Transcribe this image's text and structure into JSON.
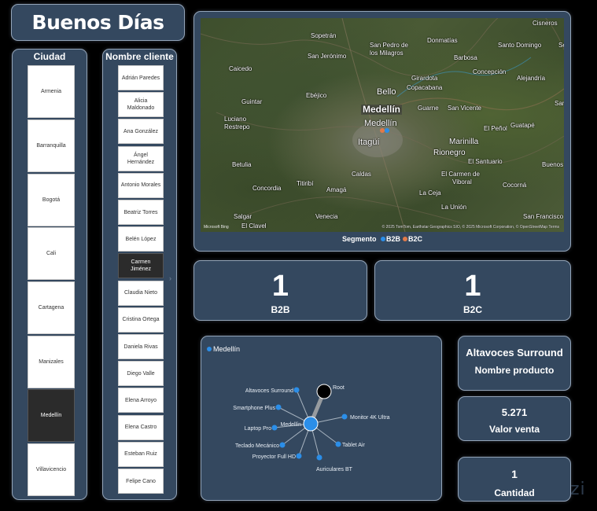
{
  "greeting": "Buenos Días",
  "city_slicer": {
    "header": "Ciudad",
    "items": [
      "Armenia",
      "Barranquilla",
      "Bogotá",
      "Cali",
      "Cartagena",
      "Manizales",
      "Medellín",
      "Villavicencio"
    ],
    "selected": "Medellín"
  },
  "client_slicer": {
    "header": "Nombre cliente",
    "items": [
      "Adrián Paredes",
      "Alicia Maldonado",
      "Ana González",
      "Ángel Hernández",
      "Antonio Morales",
      "Beatriz Torres",
      "Belén López",
      "Carmen Jiménez",
      "Claudia Nieto",
      "Cristina Ortega",
      "Daniela Rivas",
      "Diego Valle",
      "Elena Arroyo",
      "Elena Castro",
      "Esteban Ruiz",
      "Felipe Cano"
    ],
    "selected": "Carmen Jiménez",
    "scroll_arrow": "›"
  },
  "map": {
    "places": [
      {
        "name": "Cisneros",
        "cls": ""
      },
      {
        "name": "Sopetrán",
        "cls": ""
      },
      {
        "name": "Donmatías",
        "cls": ""
      },
      {
        "name": "San Pedro de",
        "cls": ""
      },
      {
        "name": "los Milagros",
        "cls": ""
      },
      {
        "name": "Santo Domingo",
        "cls": ""
      },
      {
        "name": "San Jerónimo",
        "cls": ""
      },
      {
        "name": "Barbosa",
        "cls": ""
      },
      {
        "name": "Caicedo",
        "cls": ""
      },
      {
        "name": "Concepción",
        "cls": ""
      },
      {
        "name": "Girardota",
        "cls": ""
      },
      {
        "name": "Alejandría",
        "cls": ""
      },
      {
        "name": "Copacabana",
        "cls": ""
      },
      {
        "name": "Bello",
        "cls": "big"
      },
      {
        "name": "Ebéjico",
        "cls": ""
      },
      {
        "name": "Guintar",
        "cls": ""
      },
      {
        "name": "Medellín",
        "cls": "major"
      },
      {
        "name": "Guarne",
        "cls": ""
      },
      {
        "name": "San Vicente",
        "cls": ""
      },
      {
        "name": "Luciano",
        "cls": ""
      },
      {
        "name": "Restrepo",
        "cls": ""
      },
      {
        "name": "Medellín",
        "cls": "big"
      },
      {
        "name": "El Peñol",
        "cls": ""
      },
      {
        "name": "Guatapé",
        "cls": ""
      },
      {
        "name": "Marinilla",
        "cls": "medium"
      },
      {
        "name": "Itagüí",
        "cls": "big"
      },
      {
        "name": "Rionegro",
        "cls": "medium"
      },
      {
        "name": "Betulia",
        "cls": ""
      },
      {
        "name": "El Santuario",
        "cls": ""
      },
      {
        "name": "Buenos A",
        "cls": ""
      },
      {
        "name": "Caldas",
        "cls": ""
      },
      {
        "name": "El Carmen de",
        "cls": ""
      },
      {
        "name": "Viboral",
        "cls": ""
      },
      {
        "name": "Titiribí",
        "cls": ""
      },
      {
        "name": "Concordia",
        "cls": ""
      },
      {
        "name": "Amagá",
        "cls": ""
      },
      {
        "name": "Cocorná",
        "cls": ""
      },
      {
        "name": "La Ceja",
        "cls": ""
      },
      {
        "name": "La Unión",
        "cls": ""
      },
      {
        "name": "Salgar",
        "cls": ""
      },
      {
        "name": "Venecia",
        "cls": ""
      },
      {
        "name": "San Francisco",
        "cls": ""
      },
      {
        "name": "El Clavel",
        "cls": ""
      },
      {
        "name": "San",
        "cls": ""
      },
      {
        "name": "Se",
        "cls": ""
      }
    ],
    "brand": "Microsoft Bing",
    "attribution": "© 2025 TomTom, Earthstar Geographics SIO, © 2025 Microsoft Corporation, © OpenStreetMap  Terms",
    "legend_title": "Segmento",
    "legend_items": [
      {
        "label": "B2B",
        "color": "#2b8ee8"
      },
      {
        "label": "B2C",
        "color": "#e07a4a"
      }
    ]
  },
  "kpis": {
    "b2b": {
      "value": "1",
      "label": "B2B"
    },
    "b2c": {
      "value": "1",
      "label": "B2C"
    },
    "product": {
      "value": "Altavoces Surround",
      "label": "Nombre producto"
    },
    "sales": {
      "value": "5.271",
      "label": "Valor venta"
    },
    "qty": {
      "value": "1",
      "label": "Cantidad"
    }
  },
  "tree": {
    "legend": "Medellín",
    "legend_color": "#2b8ee8",
    "center_label": "Medellín",
    "root_label": "Root",
    "leaves": [
      "Altavoces Surround",
      "Smartphone Plus",
      "Laptop Pro",
      "Teclado Mecánico",
      "Proyector Full HD",
      "Auriculares BT",
      "Tablet Air",
      "Monitor 4K Ultra"
    ],
    "node_color": "#2b8ee8",
    "root_color": "#000000"
  },
  "watermark": "zi"
}
